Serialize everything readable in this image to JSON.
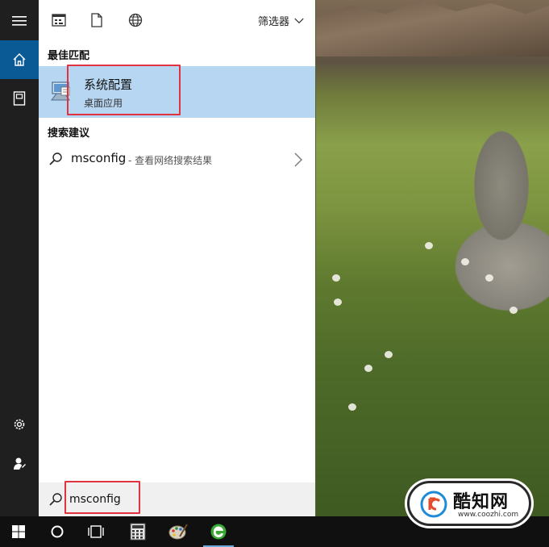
{
  "toolbar": {
    "filter_label": "筛选器",
    "icons": [
      "apps-icon",
      "documents-icon",
      "web-icon"
    ]
  },
  "best_match": {
    "section_title": "最佳匹配",
    "app_name": "系统配置",
    "app_type": "桌面应用"
  },
  "suggestions": {
    "section_title": "搜索建议",
    "items": [
      {
        "query": "msconfig",
        "description": "- 查看网络搜索结果"
      }
    ]
  },
  "search": {
    "value": "msconfig"
  },
  "rail": {
    "items": [
      "menu-icon",
      "home-icon",
      "notebook-icon",
      "settings-icon",
      "feedback-icon"
    ]
  },
  "taskbar": {
    "items": [
      "windows-start",
      "cortana",
      "task-view",
      "calculator",
      "paint",
      "browser"
    ]
  },
  "watermark": {
    "logo_text": "酷知网",
    "url": "www.coozhi.com"
  },
  "colors": {
    "accent": "#0a5a96",
    "selection": "#b7d6f1",
    "highlight_box": "#e0333f",
    "rail_bg": "#1f1f1f",
    "taskbar_bg": "#101010"
  }
}
